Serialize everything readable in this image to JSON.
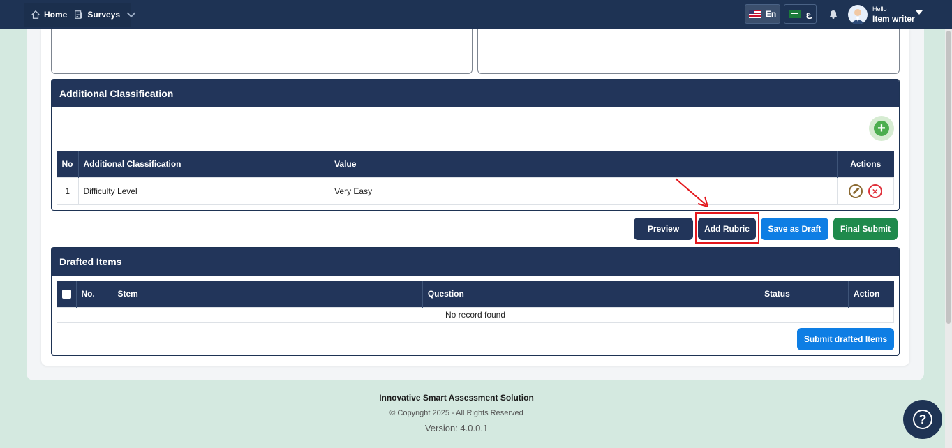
{
  "nav": {
    "home_label": "Home",
    "surveys_label": "Surveys"
  },
  "header": {
    "lang_en": "En",
    "lang_ar": "ع",
    "hello": "Hello",
    "username": "Item writer"
  },
  "additional_classification": {
    "title": "Additional Classification",
    "columns": [
      "No",
      "Additional Classification",
      "Value",
      "Actions"
    ],
    "rows": [
      {
        "no": "1",
        "classification": "Difficulty Level",
        "value": "Very Easy"
      }
    ]
  },
  "actions": {
    "preview": "Preview",
    "add_rubric": "Add Rubric",
    "save_draft": "Save as Draft",
    "final_submit": "Final Submit"
  },
  "drafted_items": {
    "title": "Drafted Items",
    "columns": [
      "No.",
      "Stem",
      "",
      "Question",
      "Status",
      "Action"
    ],
    "empty_text": "No record found",
    "submit_label": "Submit drafted Items"
  },
  "footer": {
    "title": "Innovative Smart Assessment Solution",
    "copyright": "© Copyright 2025 - All Rights Reserved",
    "version": "Version: 4.0.0.1"
  },
  "colors": {
    "navy": "#1e3354",
    "blue": "#0e7ee4",
    "green": "#1f8a4c",
    "background": "#d4e9e0",
    "highlight": "#e4171c"
  },
  "icons": [
    "home-icon",
    "surveys-icon",
    "chevron-down-icon",
    "us-flag-icon",
    "sa-flag-icon",
    "bell-icon",
    "avatar",
    "plus-icon",
    "edit-icon",
    "delete-icon",
    "help-icon"
  ]
}
